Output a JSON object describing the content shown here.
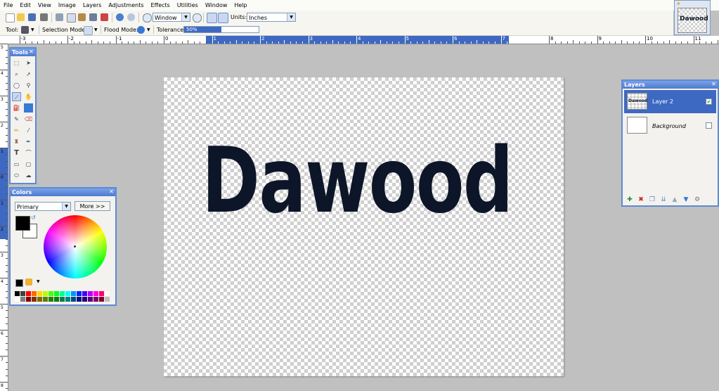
{
  "menu": [
    "File",
    "Edit",
    "View",
    "Image",
    "Layers",
    "Adjustments",
    "Effects",
    "Utilities",
    "Window",
    "Help"
  ],
  "menu_underline": [
    "F",
    "E",
    "V",
    "I",
    "L",
    "A",
    "c",
    "U",
    "W",
    "H"
  ],
  "toolbar": {
    "zoom_value": "Window",
    "units_label": "Units:",
    "units_value": "Inches",
    "tool_label": "Tool:",
    "selection_mode_label": "Selection Mode:",
    "flood_mode_label": "Flood Mode:",
    "tolerance_label": "Tolerance:",
    "tolerance_value": "50%",
    "tolerance_fraction": 0.5
  },
  "ruler": {
    "h_labels": [
      "-3",
      "-2",
      "-1",
      "0",
      "1",
      "2",
      "3",
      "4",
      "5",
      "6",
      "7",
      "8",
      "9",
      "10",
      "11"
    ],
    "v_labels": [
      "5",
      "4",
      "3",
      "2",
      "1",
      "0",
      "1",
      "2",
      "3",
      "4",
      "5",
      "6",
      "7",
      "8"
    ]
  },
  "canvas": {
    "text": "Dawood",
    "text_color": "#0d1628"
  },
  "tools_panel": {
    "title": "Tools"
  },
  "colors_panel": {
    "title": "Colors",
    "mode": "Primary",
    "more_button": "More >>",
    "primary_color": "#000000",
    "secondary_color": "#ffffff"
  },
  "layers_panel": {
    "title": "Layers",
    "layers": [
      {
        "name": "Layer 2",
        "visible": true,
        "selected": true
      },
      {
        "name": "Background",
        "visible": false,
        "selected": false
      }
    ]
  },
  "image_tab": {
    "label": "Dawood"
  },
  "colors": {
    "accent": "#3e69c2",
    "panel_border": "#5c8ad6"
  }
}
